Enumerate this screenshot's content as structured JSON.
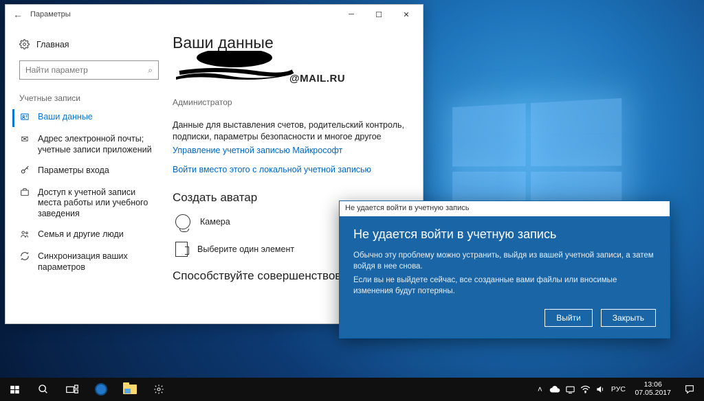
{
  "window": {
    "title": "Параметры",
    "home": "Главная",
    "search_placeholder": "Найти параметр",
    "section": "Учетные записи",
    "nav": [
      {
        "icon": "person",
        "label": "Ваши данные",
        "active": true
      },
      {
        "icon": "mail",
        "label": "Адрес электронной почты; учетные записи приложений"
      },
      {
        "icon": "key",
        "label": "Параметры входа"
      },
      {
        "icon": "briefcase",
        "label": "Доступ к учетной записи места работы или учебного заведения"
      },
      {
        "icon": "family",
        "label": "Семья и другие люди"
      },
      {
        "icon": "sync",
        "label": "Синхронизация ваших параметров"
      }
    ]
  },
  "main": {
    "heading": "Ваши данные",
    "email_suffix": "@MAIL.RU",
    "role": "Администратор",
    "desc": "Данные для выставления счетов, родительский контроль, подписки, параметры безопасности и многое другое",
    "manage_link": "Управление учетной записью Майкрософт",
    "local_link": "Войти вместо этого с локальной учетной записью",
    "avatar_heading": "Создать аватар",
    "camera": "Камера",
    "choose": "Выберите один элемент",
    "improve_heading": "Способствуйте совершенствова"
  },
  "dialog": {
    "titlebar": "Не удается войти в учетную запись",
    "heading": "Не удается войти в учетную запись",
    "p1": "Обычно эту проблему можно устранить, выйдя из вашей учетной записи, а затем войдя в нее снова.",
    "p2": "Если вы не выйдете сейчас, все созданные вами файлы или вносимые изменения будут потеряны.",
    "btn_signout": "Выйти",
    "btn_close": "Закрыть"
  },
  "taskbar": {
    "lang": "РУС",
    "time": "13:06",
    "date": "07.05.2017"
  }
}
